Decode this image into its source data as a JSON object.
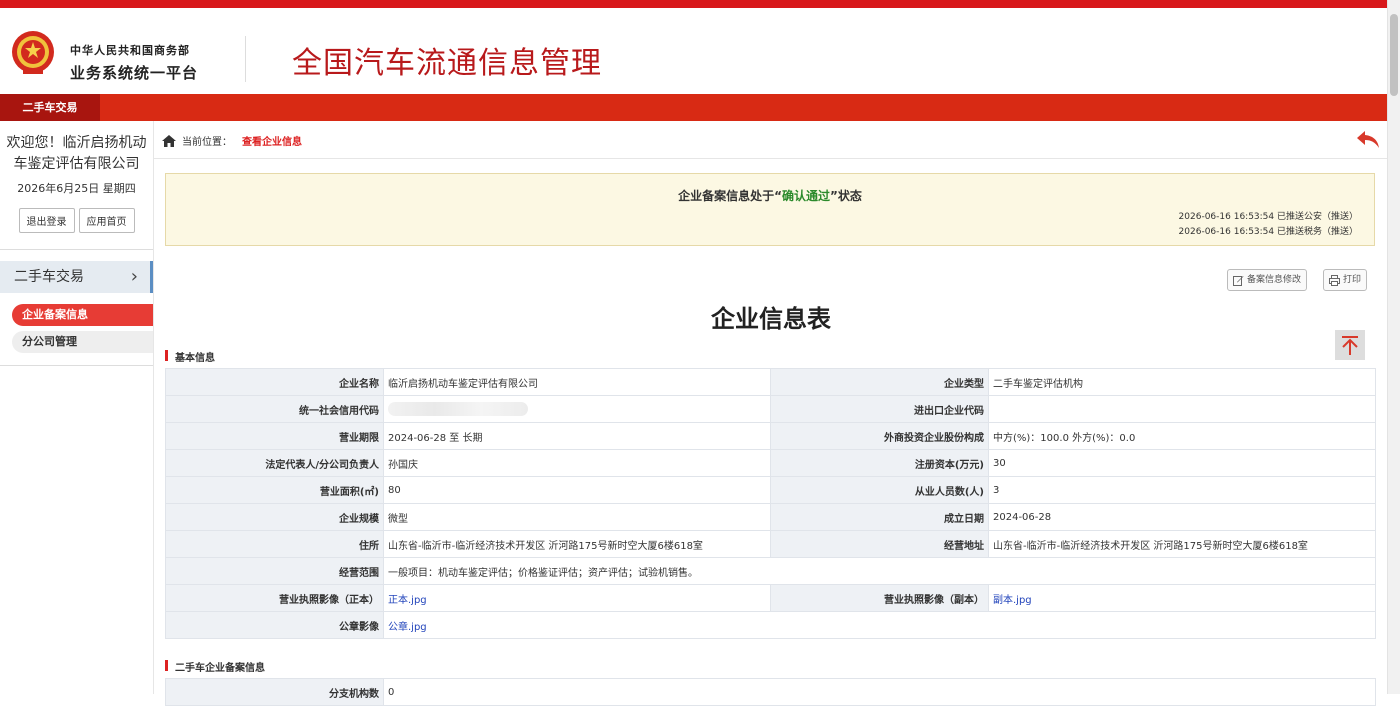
{
  "header": {
    "org_line1": "中华人民共和国商务部",
    "org_line2": "业务系统统一平台",
    "app_title": "全国汽车流通信息管理"
  },
  "nav": {
    "active_tab": "二手车交易"
  },
  "sidebar": {
    "welcome": "欢迎您！临沂启扬机动车鉴定评估有限公司",
    "date": "2026年6月25日 星期四",
    "logout": "退出登录",
    "home": "应用首页",
    "group": "二手车交易",
    "items": [
      "企业备案信息",
      "分公司管理"
    ]
  },
  "breadcrumb": {
    "label": "当前位置：",
    "current": "查看企业信息"
  },
  "notice": {
    "prefix": "企业备案信息处于“",
    "status": "确认通过",
    "suffix": "”状态",
    "log1": "2026-06-16 16:53:54 已推送公安（推送）",
    "log2": "2026-06-16 16:53:54 已推送税务（推送）"
  },
  "actions": {
    "edit": "备案信息修改",
    "print": "打印"
  },
  "form_title": "企业信息表",
  "sections": {
    "basic": "基本信息",
    "second": "二手车企业备案信息"
  },
  "basic": {
    "name_label": "企业名称",
    "name": "临沂启扬机动车鉴定评估有限公司",
    "type_label": "企业类型",
    "type": "二手车鉴定评估机构",
    "credit_label": "统一社会信用代码",
    "ie_label": "进出口企业代码",
    "ie": "",
    "term_label": "营业期限",
    "term": "2024-06-28 至  长期",
    "foreign_label": "外商投资企业股份构成",
    "foreign": "中方(%)：100.0  外方(%)：0.0",
    "legal_label": "法定代表人/分公司负责人",
    "legal": "孙国庆",
    "capital_label": "注册资本(万元)",
    "capital": "30",
    "area_label": "营业面积(㎡)",
    "area": "80",
    "staff_label": "从业人员数(人)",
    "staff": "3",
    "scale_label": "企业规模",
    "scale": "微型",
    "founded_label": "成立日期",
    "founded": "2024-06-28",
    "address_label": "住所",
    "address": "山东省-临沂市-临沂经济技术开发区 沂河路175号新时空大厦6楼618室",
    "op_address_label": "经营地址",
    "op_address": "山东省-临沂市-临沂经济技术开发区 沂河路175号新时空大厦6楼618室",
    "scope_label": "经营范围",
    "scope": "一般项目：机动车鉴定评估；价格鉴证评估；资产评估；试验机销售。",
    "lic_main_label": "营业执照影像（正本）",
    "lic_main": "正本.jpg",
    "lic_copy_label": "营业执照影像（副本）",
    "lic_copy": "副本.jpg",
    "seal_label": "公章影像",
    "seal": "公章.jpg",
    "branch_label": "分支机构数",
    "branch": "0"
  },
  "colors": {
    "brand_red": "#d82a14",
    "title_red": "#b8191b",
    "active_item": "#e73c35"
  }
}
